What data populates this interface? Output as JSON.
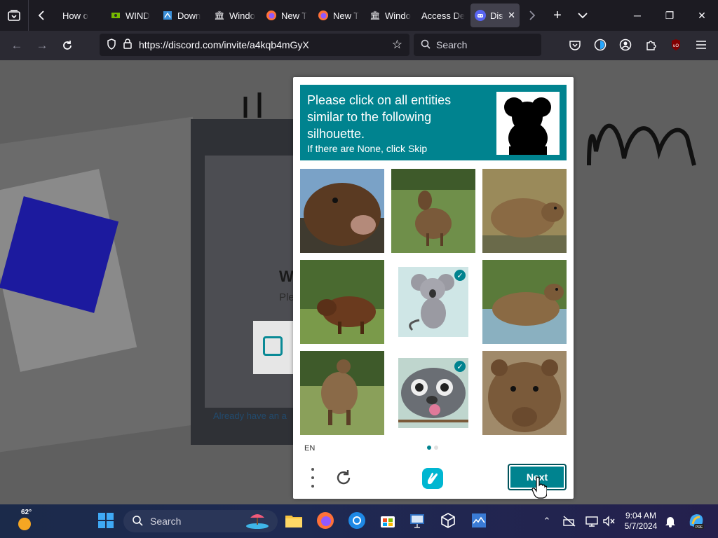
{
  "browser": {
    "tabs": [
      {
        "title": "How o",
        "icon": "page-icon",
        "active": false
      },
      {
        "title": "WIND",
        "icon": "nvidia-icon",
        "active": false
      },
      {
        "title": "Down",
        "icon": "windows-update-icon",
        "active": false
      },
      {
        "title": "Windo",
        "icon": "museum-icon",
        "active": false
      },
      {
        "title": "New T",
        "icon": "firefox-icon",
        "active": false
      },
      {
        "title": "New T",
        "icon": "firefox-icon",
        "active": false
      },
      {
        "title": "Windo",
        "icon": "museum-icon",
        "active": false
      },
      {
        "title": "Access De",
        "icon": "none",
        "active": false
      },
      {
        "title": "Dis",
        "icon": "discord-icon",
        "active": true
      }
    ],
    "url": "https://discord.com/invite/a4kqb4mGyX",
    "search_placeholder": "Search"
  },
  "background_page": {
    "title_fragment": "W",
    "subtitle_fragment": "Ple",
    "link_fragment": "Already have an a"
  },
  "captcha": {
    "prompt_main": "Please click on all entities similar to the following silhouette.",
    "prompt_sub": "If there are None, click Skip",
    "silhouette": "koala",
    "images": [
      {
        "subject": "boar",
        "selected": false
      },
      {
        "subject": "capybara",
        "selected": false
      },
      {
        "subject": "capybara",
        "selected": false
      },
      {
        "subject": "capybara",
        "selected": false
      },
      {
        "subject": "koala",
        "selected": true
      },
      {
        "subject": "capybara",
        "selected": false
      },
      {
        "subject": "capybara",
        "selected": false
      },
      {
        "subject": "koala",
        "selected": true
      },
      {
        "subject": "capybara",
        "selected": false
      }
    ],
    "language": "EN",
    "page_indicator": {
      "current": 1,
      "total": 2
    },
    "next_label": "Next",
    "accent_color": "#00838f"
  },
  "taskbar": {
    "weather_temp": "62°",
    "search_label": "Search",
    "time": "9:04 AM",
    "date": "5/7/2024",
    "pinned": [
      "start-icon",
      "search-icon",
      "beach-widget-icon",
      "file-explorer-icon",
      "firefox-icon",
      "chrome-icon",
      "microsoft-store-icon",
      "presentation-icon",
      "3d-box-icon",
      "task-manager-icon"
    ]
  }
}
